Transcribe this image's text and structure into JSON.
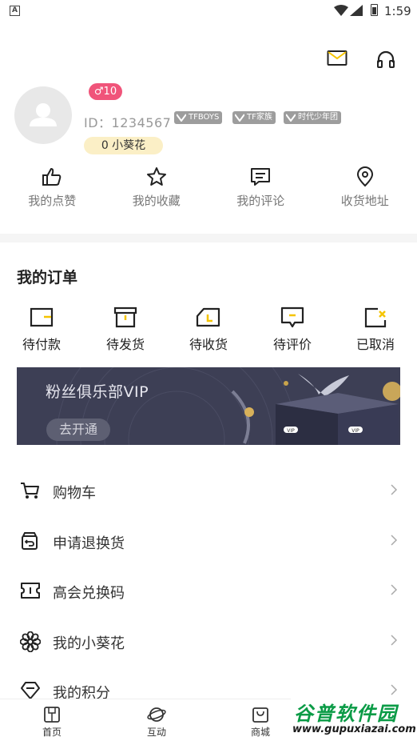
{
  "status_bar": {
    "time": "1:59",
    "notification": "A"
  },
  "profile": {
    "level": "♂10",
    "id_text": "ID：1234567",
    "tags": [
      "TFBOYS",
      "TF家族",
      "时代少年团"
    ],
    "flower_count": "0 小葵花"
  },
  "quick_actions": [
    {
      "label": "我的点赞",
      "icon": "thumbs-up-icon"
    },
    {
      "label": "我的收藏",
      "icon": "star-icon"
    },
    {
      "label": "我的评论",
      "icon": "comment-icon"
    },
    {
      "label": "收货地址",
      "icon": "location-pin-icon"
    }
  ],
  "orders": {
    "title": "我的订单",
    "items": [
      {
        "label": "待付款",
        "icon": "wallet-icon"
      },
      {
        "label": "待发货",
        "icon": "box-icon"
      },
      {
        "label": "待收货",
        "icon": "truck-icon"
      },
      {
        "label": "待评价",
        "icon": "review-icon"
      },
      {
        "label": "已取消",
        "icon": "cancelled-icon"
      }
    ]
  },
  "vip_banner": {
    "title": "粉丝俱乐部VIP",
    "button": "去开通",
    "gift_label": "VIP"
  },
  "menu": [
    {
      "label": "购物车",
      "icon": "cart-icon"
    },
    {
      "label": "申请退换货",
      "icon": "return-icon"
    },
    {
      "label": "高会兑换码",
      "icon": "ticket-icon"
    },
    {
      "label": "我的小葵花",
      "icon": "flower-icon"
    },
    {
      "label": "我的积分",
      "icon": "diamond-icon"
    }
  ],
  "bottom_nav": [
    {
      "label": "首页",
      "icon": "home-icon"
    },
    {
      "label": "互动",
      "icon": "planet-icon"
    },
    {
      "label": "商城",
      "icon": "shopping-bag-icon"
    }
  ],
  "watermark": {
    "text": "谷普软件园",
    "url": "www.gupuxiazai.com"
  },
  "colors": {
    "level_badge": "#f0547a",
    "flower_pill": "#fbefc6",
    "vip_bg": "#3d3f55",
    "accent_yellow": "#f5c400",
    "watermark_green": "#0a9b46"
  }
}
